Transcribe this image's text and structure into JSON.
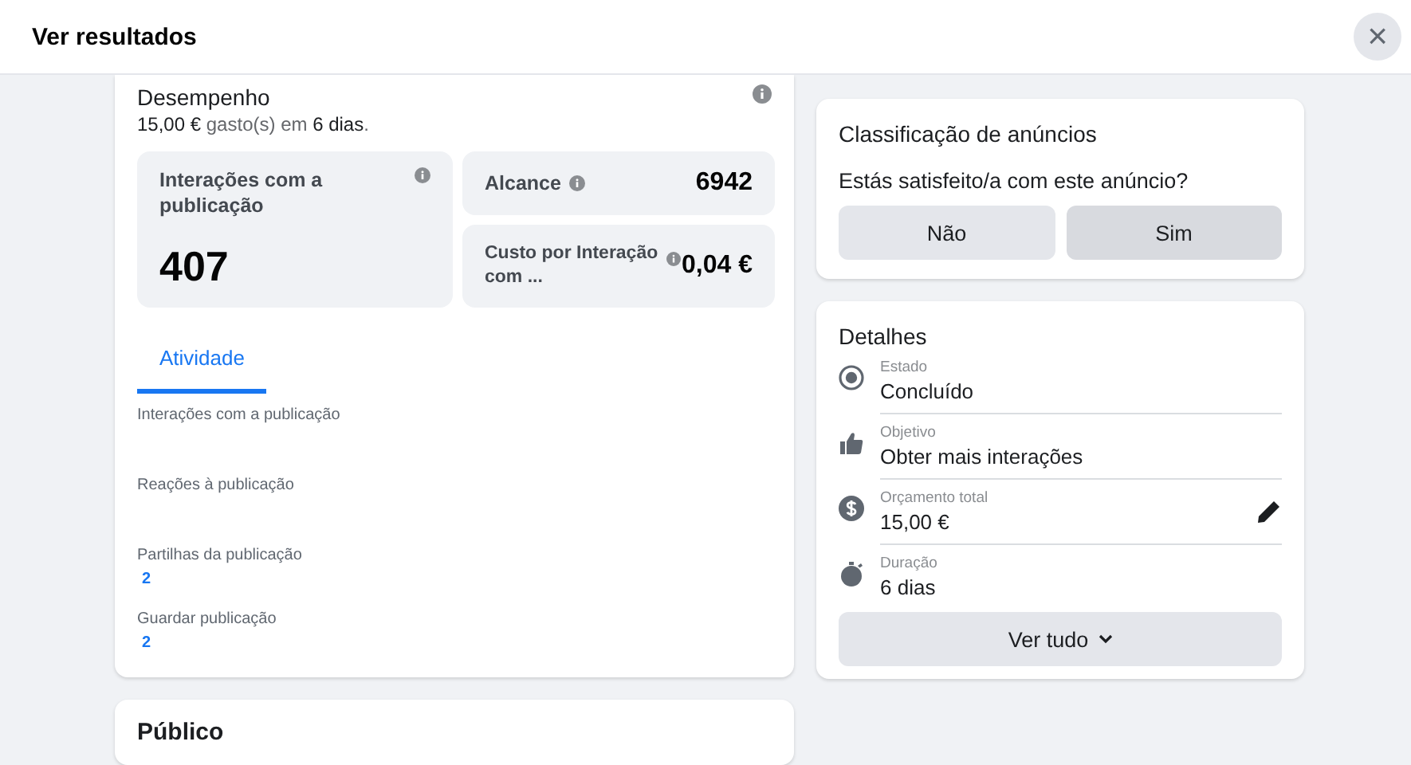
{
  "dialog": {
    "title": "Ver resultados",
    "close": "×"
  },
  "performance": {
    "title": "Desempenho",
    "summary": "**15,00 €** gasto(s) em **6 dias**.",
    "main_metric": {
      "label": "Interações com a publicação",
      "value": "407"
    },
    "reach": {
      "label": "Alcance",
      "value": "6942"
    },
    "cost": {
      "label": "Custo por Interação com ...",
      "value": "0,04 €"
    },
    "tabs": [
      {
        "label": "Atividade",
        "selected": true
      }
    ],
    "activity": [
      {
        "label": "Interações com a publicação"
      },
      {
        "label": "Reações à publicação"
      },
      {
        "label": "Partilhas da publicação",
        "value": "2"
      },
      {
        "label": "Guardar publicação",
        "value": "2"
      }
    ]
  },
  "audience": {
    "title": "Público"
  },
  "rating": {
    "title": "Classificação de anúncios",
    "question": "Estás satisfeito/a com este anúncio?",
    "options": [
      {
        "label": "Não",
        "selected": false
      },
      {
        "label": "Sim",
        "selected": true
      }
    ]
  },
  "details": {
    "title": "Detalhes",
    "items": [
      {
        "kind": "status",
        "label": "Estado",
        "value": "Concluído"
      },
      {
        "kind": "objective",
        "label": "Objetivo",
        "value": "Obter mais interações"
      },
      {
        "kind": "budget",
        "label": "Orçamento total",
        "value": "15,00 €",
        "editable": true
      },
      {
        "kind": "duration",
        "label": "Duração",
        "value": "6 dias"
      }
    ],
    "see_all": "Ver tudo"
  }
}
